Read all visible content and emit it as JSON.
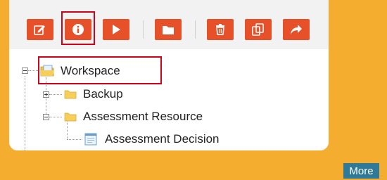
{
  "toolbar": {
    "buttons": [
      {
        "name": "edit-button",
        "icon": "edit-icon"
      },
      {
        "name": "info-button",
        "icon": "info-icon",
        "highlighted": true
      },
      {
        "name": "run-button",
        "icon": "play-icon"
      },
      {
        "name": "folder-button",
        "icon": "folder-icon"
      },
      {
        "name": "delete-button",
        "icon": "trash-icon"
      },
      {
        "name": "copy-button",
        "icon": "copy-icon"
      },
      {
        "name": "share-button",
        "icon": "share-icon"
      }
    ],
    "accent_color": "#e6512a",
    "highlight_color": "#d0021b"
  },
  "tree": {
    "root": {
      "label": "Workspace",
      "expanded": true,
      "highlighted": true
    },
    "children": [
      {
        "label": "Backup",
        "expanded": false,
        "type": "folder"
      },
      {
        "label": "Assessment Resource",
        "expanded": true,
        "type": "folder",
        "children": [
          {
            "label": "Assessment Decision",
            "type": "document"
          }
        ]
      }
    ]
  },
  "footer": {
    "more_label": "More",
    "more_color": "#2f7a99"
  },
  "background_color": "#f4ad2e"
}
